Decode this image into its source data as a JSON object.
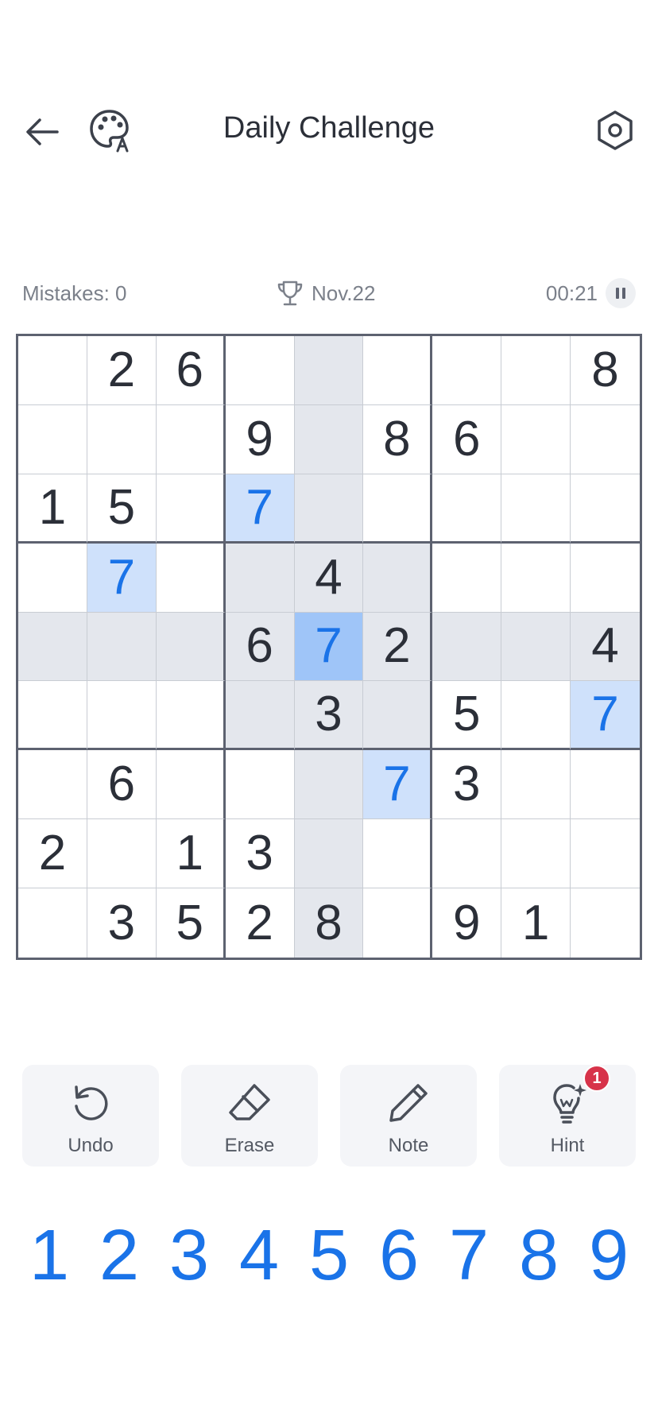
{
  "header": {
    "title": "Daily Challenge",
    "icons": {
      "back": "arrow-left-icon",
      "theme": "palette-icon",
      "settings": "gear-icon"
    }
  },
  "status": {
    "mistakes": "Mistakes: 0",
    "date": "Nov.22",
    "timer": "00:21",
    "icons": {
      "trophy": "trophy-icon",
      "pause": "pause-icon"
    }
  },
  "board": {
    "selected": [
      4,
      4
    ],
    "cells": [
      [
        "",
        "2",
        "6",
        "",
        "",
        "",
        "",
        "",
        "8"
      ],
      [
        "",
        "",
        "",
        "9",
        "",
        "8",
        "6",
        "",
        ""
      ],
      [
        "1",
        "5",
        "",
        "7",
        "",
        "",
        "",
        "",
        ""
      ],
      [
        "",
        "7",
        "",
        "",
        "4",
        "",
        "",
        "",
        ""
      ],
      [
        "",
        "",
        "",
        "6",
        "7",
        "2",
        "",
        "",
        "4"
      ],
      [
        "",
        "",
        "",
        "",
        "3",
        "",
        "5",
        "",
        "7"
      ],
      [
        "",
        "6",
        "",
        "",
        "",
        "7",
        "3",
        "",
        ""
      ],
      [
        "2",
        "",
        "1",
        "3",
        "",
        "",
        "",
        "",
        ""
      ],
      [
        "",
        "3",
        "5",
        "2",
        "8",
        "",
        "9",
        "1",
        ""
      ]
    ],
    "colors": {
      "given_digit": "#2b2f38",
      "highlight_digit": "#1a73e8",
      "related_bg": "#e4e7ed",
      "same_number_bg": "#cfe1fb",
      "selected_bg": "#9fc5f8"
    }
  },
  "tools": [
    {
      "id": "undo",
      "label": "Undo",
      "icon": "undo-icon"
    },
    {
      "id": "erase",
      "label": "Erase",
      "icon": "eraser-icon"
    },
    {
      "id": "note",
      "label": "Note",
      "icon": "pencil-icon"
    },
    {
      "id": "hint",
      "label": "Hint",
      "icon": "lightbulb-icon",
      "badge": "1"
    }
  ],
  "numpad": [
    "1",
    "2",
    "3",
    "4",
    "5",
    "6",
    "7",
    "8",
    "9"
  ]
}
